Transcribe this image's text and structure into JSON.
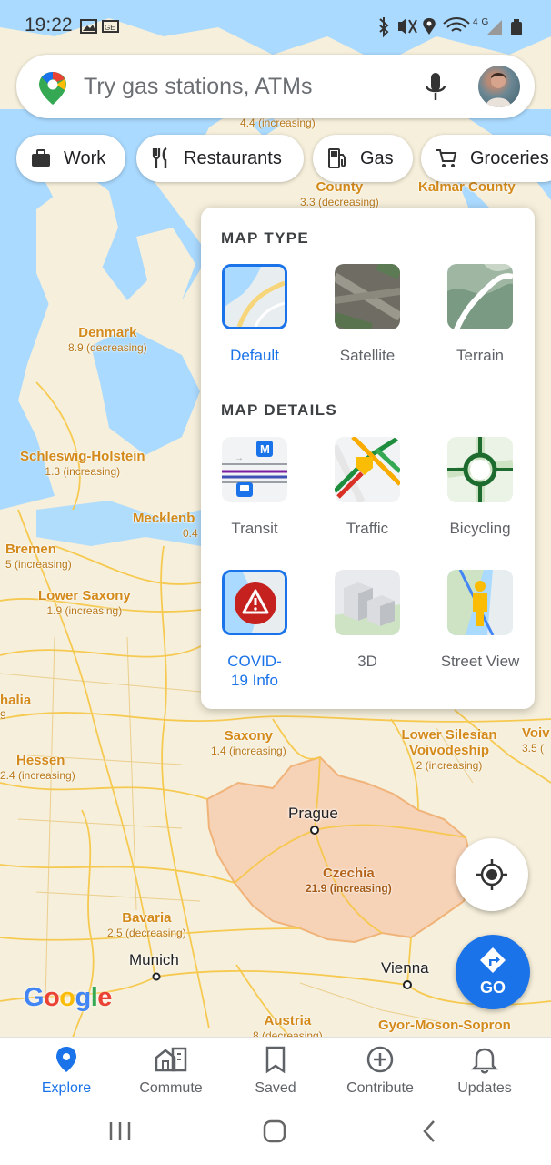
{
  "status_bar": {
    "time": "19:22",
    "signal_label": "4G"
  },
  "search": {
    "placeholder": "Try gas stations, ATMs"
  },
  "chips": [
    {
      "label": "Work",
      "icon": "briefcase-icon"
    },
    {
      "label": "Restaurants",
      "icon": "fork-knife-icon"
    },
    {
      "label": "Gas",
      "icon": "gas-pump-icon"
    },
    {
      "label": "Groceries",
      "icon": "cart-icon"
    }
  ],
  "map_layers": {
    "map_type_heading": "MAP TYPE",
    "map_types": [
      {
        "label": "Default",
        "selected": true
      },
      {
        "label": "Satellite",
        "selected": false
      },
      {
        "label": "Terrain",
        "selected": false
      }
    ],
    "map_details_heading": "MAP DETAILS",
    "details": [
      {
        "label": "Transit",
        "selected": false
      },
      {
        "label": "Traffic",
        "selected": false
      },
      {
        "label": "Bicycling",
        "selected": false
      },
      {
        "label": "COVID-19 Info",
        "selected": true
      },
      {
        "label": "3D",
        "selected": false
      },
      {
        "label": "Street View",
        "selected": false
      }
    ]
  },
  "map": {
    "regions": [
      {
        "name": "Denmark",
        "stat": "8.9 (decreasing)"
      },
      {
        "name": "Schleswig-Holstein",
        "stat": "1.3 (increasing)"
      },
      {
        "name": "Mecklenb",
        "stat": "0.4"
      },
      {
        "name": "Bremen",
        "stat": "5 (increasing)"
      },
      {
        "name": "Lower Saxony",
        "stat": "1.9 (increasing)"
      },
      {
        "name": "halia",
        "stat": "9"
      },
      {
        "name": "Hessen",
        "stat": "2.4 (increasing)"
      },
      {
        "name": "Saxony",
        "stat": "1.4 (increasing)"
      },
      {
        "name": "Lower Silesian Voivodeship",
        "stat": "2 (increasing)"
      },
      {
        "name": "Czechia",
        "stat": "21.9 (increasing)"
      },
      {
        "name": "Bavaria",
        "stat": "2.5 (decreasing)"
      },
      {
        "name": "Austria",
        "stat": "8 (decreasing)"
      },
      {
        "name": "County",
        "stat": "3.3 (decreasing)"
      },
      {
        "name": "Kalmar County",
        "stat": ""
      },
      {
        "name": "Gyor-Moson-Sopron",
        "stat": ""
      },
      {
        "name": "Voiv",
        "stat": "3.5 ("
      }
    ],
    "top_stat": "4.4 (increasing)",
    "cities": [
      "Prague",
      "Munich",
      "Vienna"
    ],
    "google_logo": "Google"
  },
  "fab": {
    "go_label": "GO"
  },
  "bottom_nav": [
    {
      "label": "Explore",
      "active": true
    },
    {
      "label": "Commute",
      "active": false
    },
    {
      "label": "Saved",
      "active": false
    },
    {
      "label": "Contribute",
      "active": false
    },
    {
      "label": "Updates",
      "active": false
    }
  ],
  "colors": {
    "accent": "#1a73e8",
    "map_bg": "#f6efdb",
    "water": "#aadaff",
    "road": "#f7c84a",
    "covid_fill": "#f6d2b6",
    "region_label": "#d48a1a"
  }
}
